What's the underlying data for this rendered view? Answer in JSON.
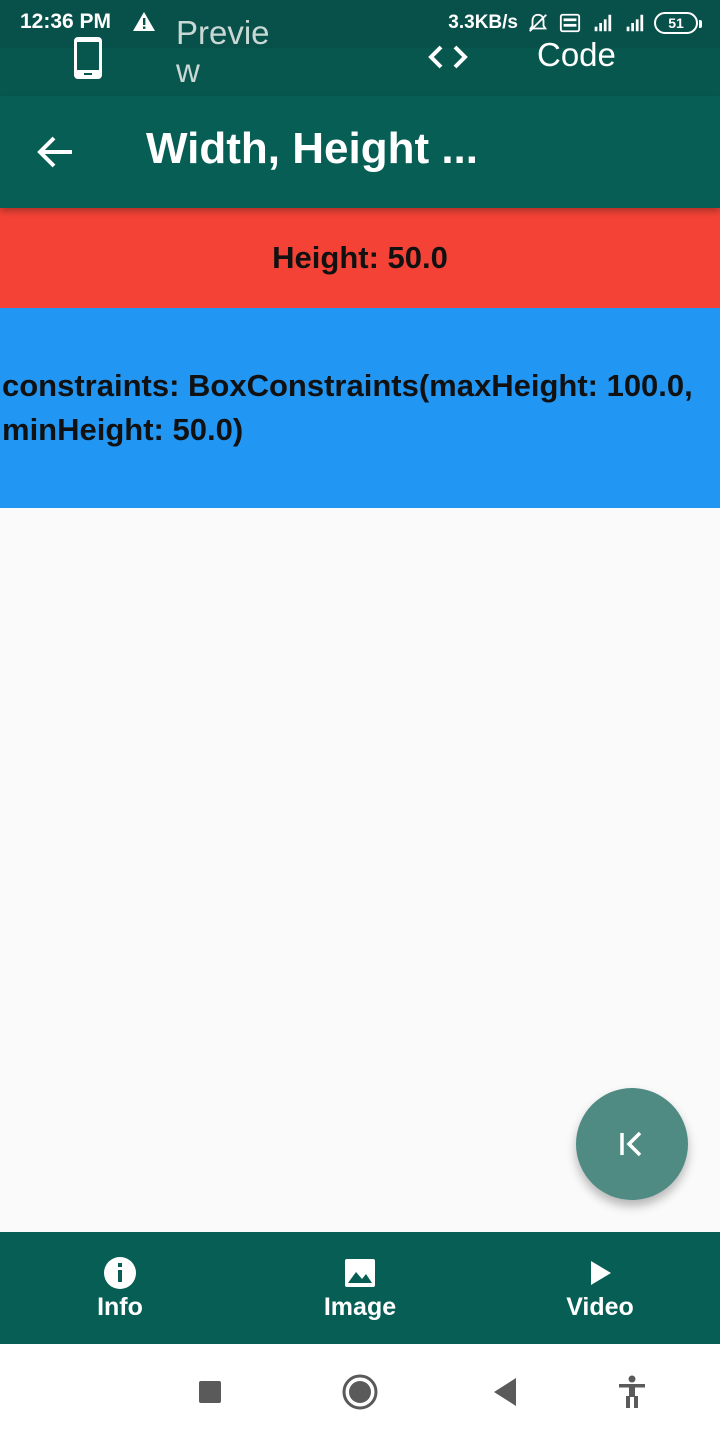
{
  "status_bar": {
    "time": "12:36 PM",
    "network_speed": "3.3KB/s",
    "battery": "51"
  },
  "tabs": {
    "preview_label": "Preview",
    "code_label": "Code"
  },
  "app_bar": {
    "title": "Width, Height ..."
  },
  "content": {
    "red_box_text": "Height: 50.0",
    "blue_box_text": "constraints: BoxConstraints(maxHeight: 100.0, minHeight: 50.0)"
  },
  "bottom_nav": {
    "items": [
      {
        "label": "Info",
        "icon": "info-icon"
      },
      {
        "label": "Image",
        "icon": "image-icon"
      },
      {
        "label": "Video",
        "icon": "play-icon"
      }
    ]
  },
  "colors": {
    "primary": "#075e54",
    "red_box": "#f44336",
    "blue_box": "#2196f3",
    "fab": "#4f8b82"
  }
}
